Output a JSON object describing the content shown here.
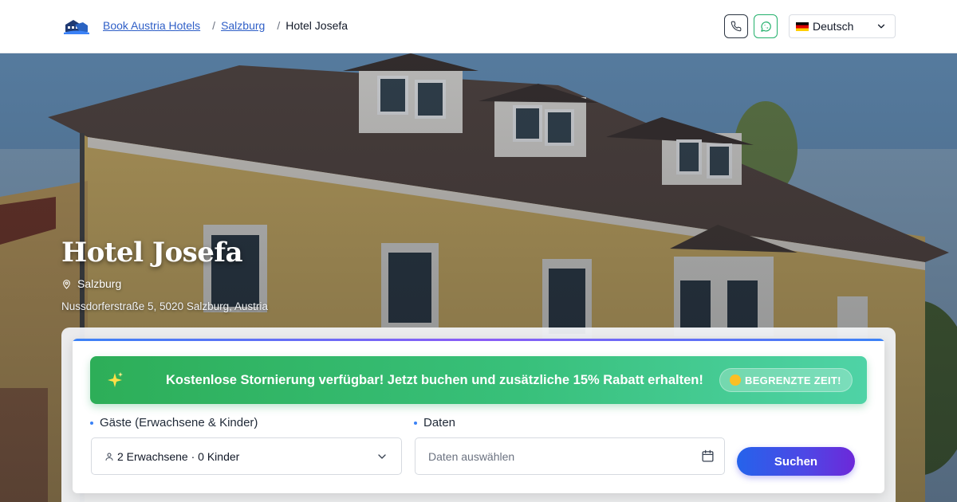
{
  "header": {
    "breadcrumb": [
      {
        "label": "Book Austria Hotels"
      },
      {
        "label": "Salzburg"
      },
      {
        "label": "Hotel Josefa"
      }
    ],
    "language": {
      "selected": "Deutsch",
      "flag": "de-flag"
    },
    "icons": {
      "phone": "phone-icon",
      "whatsapp": "whatsapp-icon",
      "logo": "hotel-logo-icon"
    }
  },
  "hero": {
    "title": "Hotel Josefa",
    "city": "Salzburg",
    "address": "Nussdorferstraße 5, 5020 Salzburg, Austria"
  },
  "booking": {
    "promo_text": "Kostenlose Stornierung verfügbar! Jetzt buchen und zusätzliche 15% Rabatt erhalten!",
    "promo_badge": "BEGRENZTE ZEIT!",
    "guests_label": "Gäste (Erwachsene & Kinder)",
    "guests_value": "2 Erwachsene · 0 Kinder",
    "dates_label": "Daten",
    "dates_placeholder": "Daten auswählen",
    "search_label": "Suchen"
  },
  "colors": {
    "accent_blue": "#2563eb",
    "accent_purple": "#6d28d9",
    "promo_green": "#2dae58",
    "whatsapp_green": "#22b06b",
    "link_blue": "#2f5fc7"
  }
}
